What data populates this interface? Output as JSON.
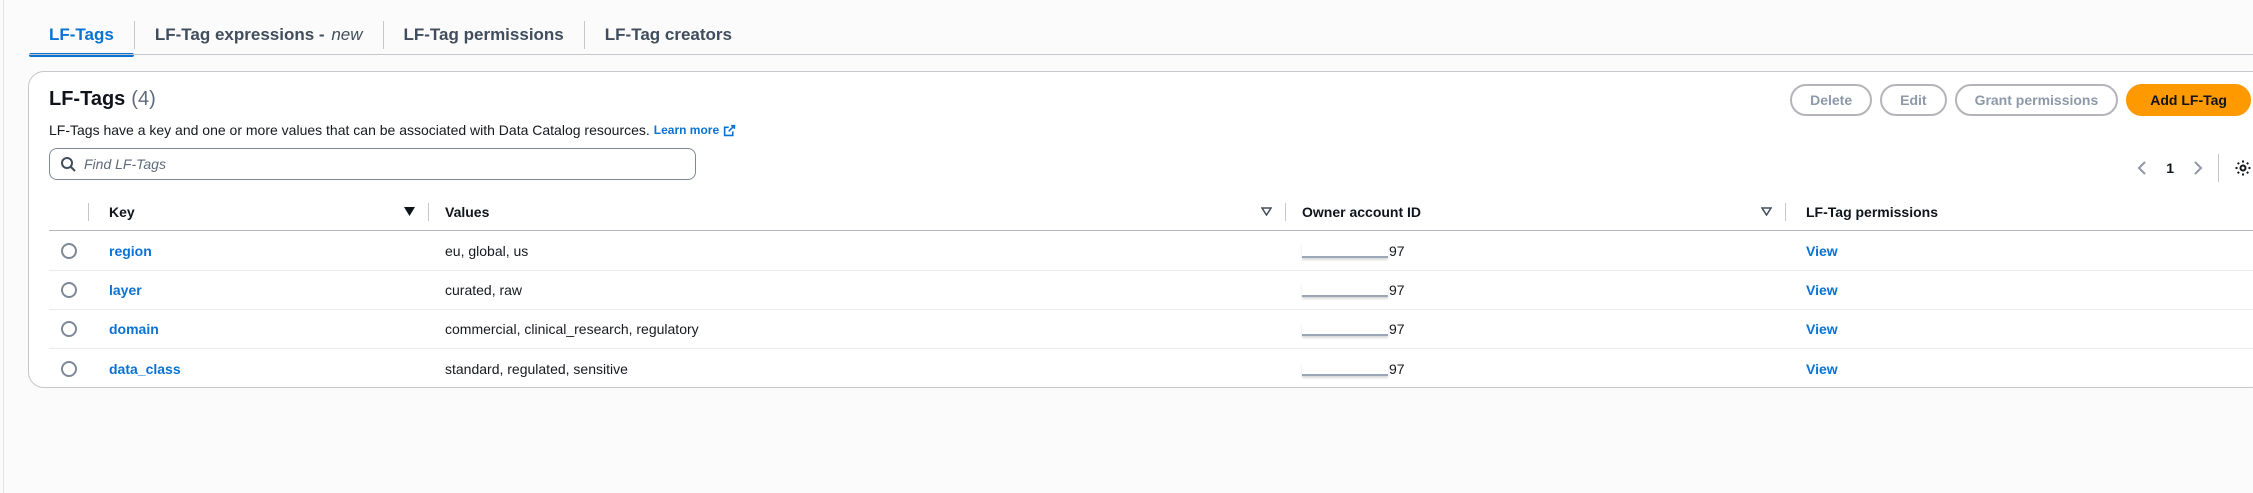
{
  "tabs": [
    {
      "label": "LF-Tags",
      "suffix": ""
    },
    {
      "label": "LF-Tag expressions - ",
      "suffix": "new"
    },
    {
      "label": "LF-Tag permissions",
      "suffix": ""
    },
    {
      "label": "LF-Tag creators",
      "suffix": ""
    }
  ],
  "header": {
    "title": "LF-Tags",
    "count": "(4)",
    "description": "LF-Tags have a key and one or more values that can be associated with Data Catalog resources.",
    "learn_more": "Learn more"
  },
  "actions": {
    "delete": "Delete",
    "edit": "Edit",
    "grant": "Grant permissions",
    "add": "Add LF-Tag"
  },
  "search": {
    "placeholder": "Find LF-Tags",
    "value": ""
  },
  "pagination": {
    "current_page": "1"
  },
  "table": {
    "columns": [
      "Key",
      "Values",
      "Owner account ID",
      "LF-Tag permissions"
    ],
    "rows": [
      {
        "key": "region",
        "values": "eu, global, us",
        "owner_suffix": "97",
        "permission": "View"
      },
      {
        "key": "layer",
        "values": "curated, raw",
        "owner_suffix": "97",
        "permission": "View"
      },
      {
        "key": "domain",
        "values": "commercial, clinical_research, regulatory",
        "owner_suffix": "97",
        "permission": "View"
      },
      {
        "key": "data_class",
        "values": "standard, regulated, sensitive",
        "owner_suffix": "97",
        "permission": "View"
      }
    ]
  },
  "colors": {
    "accent": "#0972d3",
    "primary_button": "#ff9900",
    "border": "#c6c6cd"
  },
  "icons": [
    "search-icon",
    "external-link-icon",
    "chevron-left-icon",
    "chevron-right-icon",
    "settings-icon",
    "sort-desc-icon",
    "sort-icon"
  ]
}
